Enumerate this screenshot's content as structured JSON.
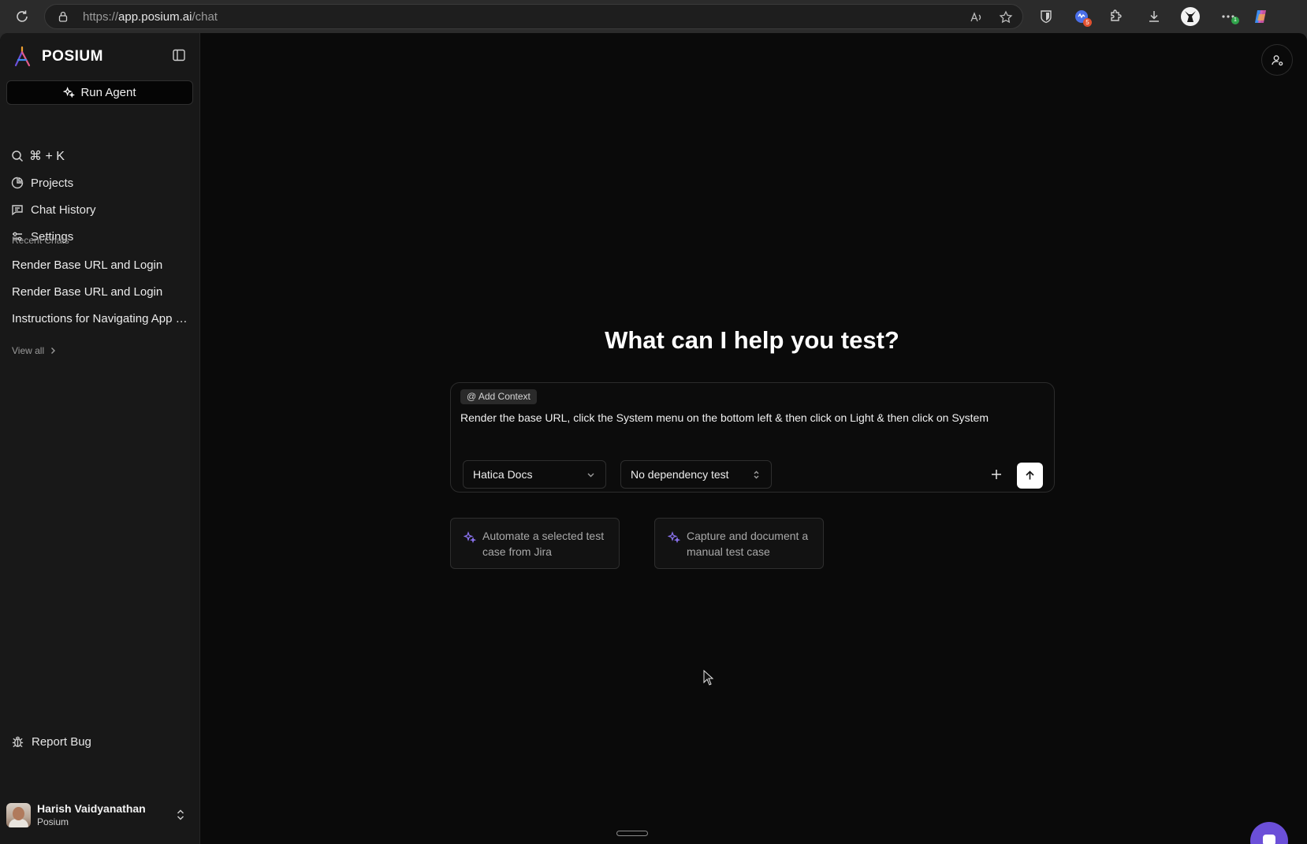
{
  "browser": {
    "url_prefix": "https://",
    "url_host": "app.posium.ai",
    "url_path": "/chat",
    "extension_badge": "5",
    "menu_badge": "1"
  },
  "sidebar": {
    "brand": "POSIUM",
    "run_agent_label": "Run Agent",
    "search_shortcut": "⌘ + K",
    "nav_items": [
      {
        "label": "Projects",
        "icon": "pie-chart-icon"
      },
      {
        "label": "Chat History",
        "icon": "chat-icon"
      },
      {
        "label": "Settings",
        "icon": "sliders-icon"
      }
    ],
    "recent_label": "Recent Chats",
    "recent_chats": [
      "Render Base URL and Login",
      "Render Base URL and Login",
      "Instructions for Navigating App to…"
    ],
    "view_all_label": "View all",
    "report_bug_label": "Report Bug",
    "user": {
      "name": "Harish Vaidyanathan",
      "org": "Posium"
    }
  },
  "main": {
    "headline": "What can I help you test?",
    "composer": {
      "context_chip": "@ Add Context",
      "prompt_value": "Render the base URL, click the  System menu on the bottom left & then click on Light & then click on System",
      "project_select": "Hatica Docs",
      "dependency_select": "No dependency test"
    },
    "suggestions": [
      "Automate a selected test case from Jira",
      "Capture and document a manual test case"
    ]
  },
  "colors": {
    "accent": "#6b4fd8",
    "sparkle": "#8b73f0",
    "background": "#0a0a0a",
    "sidebar": "#181818"
  }
}
